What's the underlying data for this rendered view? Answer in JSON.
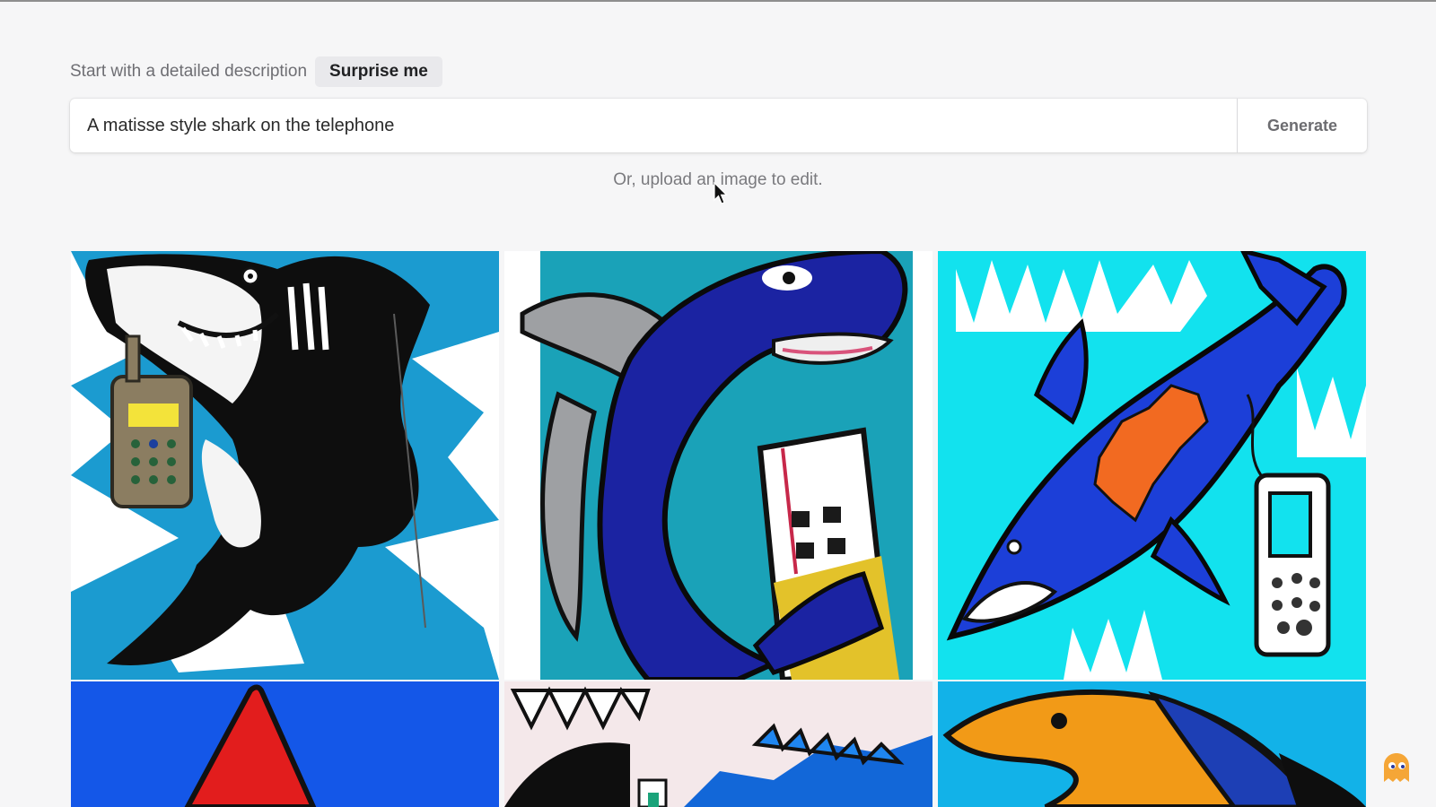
{
  "prompt": {
    "label": "Start with a detailed description",
    "surprise_label": "Surprise me",
    "value": "A matisse style shark on the telephone",
    "generate_label": "Generate"
  },
  "upload": {
    "text": "Or, upload an image to edit."
  },
  "results": {
    "images": [
      {
        "subject": "black-and-white shark holding a cell phone on blue zigzag background"
      },
      {
        "subject": "dark blue shark with grey fin beside a white building-like phone"
      },
      {
        "subject": "blue shark with orange markings and a dangling phone on cyan background"
      },
      {
        "subject": "red fin shape on bright blue background"
      },
      {
        "subject": "black and white shape with blue zigzag teeth"
      },
      {
        "subject": "orange fish head on blue background"
      }
    ]
  },
  "icons": {
    "cursor": "arrow-cursor-icon",
    "mascot": "ghost-mascot-icon"
  },
  "colors": {
    "background": "#f6f6f7",
    "surprise_bg": "#e9e9ec",
    "generate_text": "#6c6c70"
  }
}
